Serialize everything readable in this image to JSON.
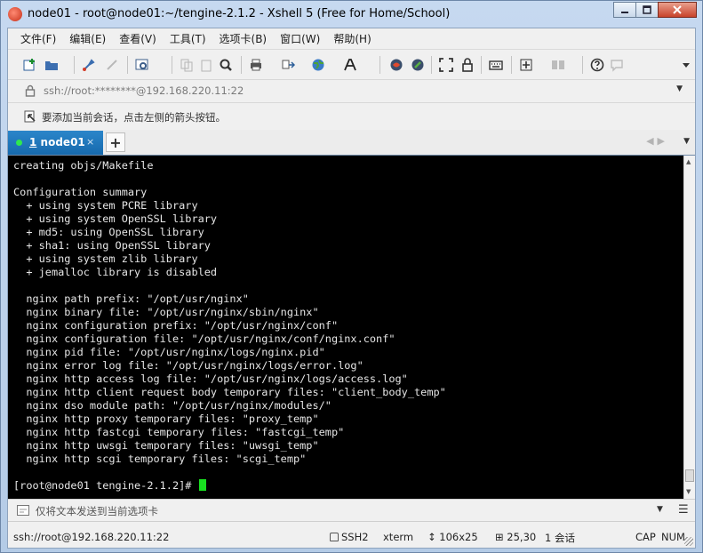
{
  "window": {
    "title": "node01 - root@node01:~/tengine-2.1.2 - Xshell 5 (Free for Home/School)",
    "minimize": "0",
    "maximize": "1",
    "close": "x"
  },
  "menu": [
    "文件(F)",
    "编辑(E)",
    "查看(V)",
    "工具(T)",
    "选项卡(B)",
    "窗口(W)",
    "帮助(H)"
  ],
  "toolbar": {
    "icons": [
      "new-session-icon",
      "open-folder-icon",
      "connect-icon",
      "disconnect-icon",
      "properties-icon",
      "copy-icon",
      "paste-icon",
      "find-icon",
      "print-icon",
      "transfer-icon",
      "globe-icon",
      "font-icon",
      "xftp-icon",
      "xmanager-icon",
      "fullscreen-icon",
      "lock-icon",
      "keyboard-icon",
      "add-icon",
      "layout-icon",
      "help-icon",
      "chat-icon"
    ]
  },
  "address": {
    "value": "ssh://root:********@192.168.220.11:22"
  },
  "hint": {
    "text": "要添加当前会话，点击左侧的箭头按钮。"
  },
  "tab": {
    "number": "1",
    "label": "node01",
    "close": "×",
    "add": "+"
  },
  "terminal": {
    "lines": [
      "creating objs/Makefile",
      "",
      "Configuration summary",
      "  + using system PCRE library",
      "  + using system OpenSSL library",
      "  + md5: using OpenSSL library",
      "  + sha1: using OpenSSL library",
      "  + using system zlib library",
      "  + jemalloc library is disabled",
      "",
      "  nginx path prefix: \"/opt/usr/nginx\"",
      "  nginx binary file: \"/opt/usr/nginx/sbin/nginx\"",
      "  nginx configuration prefix: \"/opt/usr/nginx/conf\"",
      "  nginx configuration file: \"/opt/usr/nginx/conf/nginx.conf\"",
      "  nginx pid file: \"/opt/usr/nginx/logs/nginx.pid\"",
      "  nginx error log file: \"/opt/usr/nginx/logs/error.log\"",
      "  nginx http access log file: \"/opt/usr/nginx/logs/access.log\"",
      "  nginx http client request body temporary files: \"client_body_temp\"",
      "  nginx dso module path: \"/opt/usr/nginx/modules/\"",
      "  nginx http proxy temporary files: \"proxy_temp\"",
      "  nginx http fastcgi temporary files: \"fastcgi_temp\"",
      "  nginx http uwsgi temporary files: \"uwsgi_temp\"",
      "  nginx http scgi temporary files: \"scgi_temp\"",
      "",
      "[root@node01 tengine-2.1.2]# "
    ]
  },
  "sendbar": {
    "placeholder": "仅将文本发送到当前选项卡"
  },
  "status": {
    "connection": "ssh://root@192.168.220.11:22",
    "protocol": "SSH2",
    "terminal_type": "xterm",
    "size": "106x25",
    "position": "25,30",
    "sessions": "1 会话",
    "caps": "CAP",
    "num": "NUM"
  },
  "colors": {
    "tab_active": "#1d74b9",
    "cursor": "#18e020",
    "terminal_bg": "#000000",
    "terminal_fg": "#e6e6e6"
  }
}
